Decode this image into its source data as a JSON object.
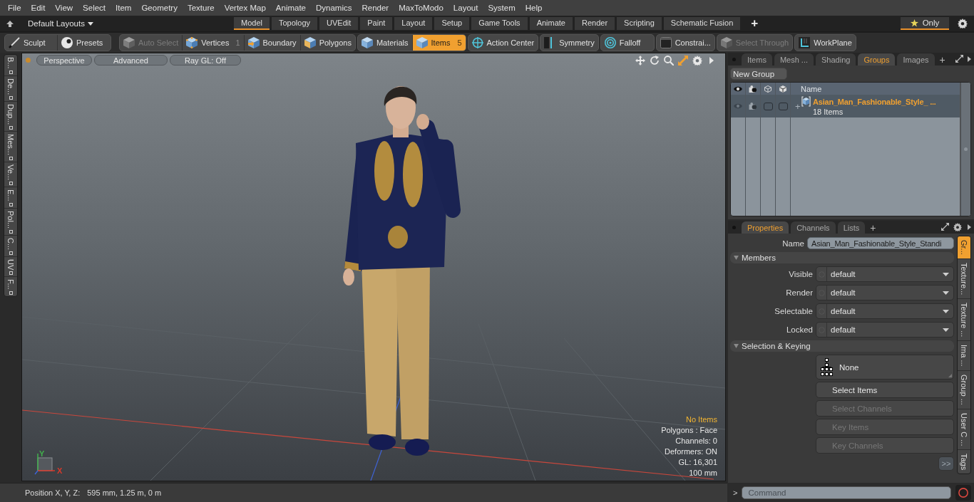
{
  "menu_bar": {
    "items": [
      "File",
      "Edit",
      "View",
      "Select",
      "Item",
      "Geometry",
      "Texture",
      "Vertex Map",
      "Animate",
      "Dynamics",
      "Render",
      "MaxToModo",
      "Layout",
      "System",
      "Help"
    ]
  },
  "layout_bar": {
    "layout_menu": "Default Layouts",
    "tabs": [
      {
        "label": "Model",
        "selected": true
      },
      {
        "label": "Topology",
        "selected": false
      },
      {
        "label": "UVEdit",
        "selected": false
      },
      {
        "label": "Paint",
        "selected": false
      },
      {
        "label": "Layout",
        "selected": false
      },
      {
        "label": "Setup",
        "selected": false
      },
      {
        "label": "Game Tools",
        "selected": false
      },
      {
        "label": "Animate",
        "selected": false
      },
      {
        "label": "Render",
        "selected": false
      },
      {
        "label": "Scripting",
        "selected": false
      },
      {
        "label": "Schematic Fusion",
        "selected": false
      }
    ],
    "add_tab": "+",
    "filter": {
      "label": "Only",
      "selected": true
    }
  },
  "toolbar": {
    "groups": [
      [
        {
          "label": "Sculpt",
          "selected": false,
          "disabled": false
        },
        {
          "label": "Presets",
          "selected": false,
          "disabled": false
        }
      ],
      [
        {
          "label": "Auto Select",
          "selected": false,
          "disabled": true
        },
        {
          "label": "Vertices",
          "selected": false,
          "disabled": false,
          "count": "1"
        },
        {
          "label": "Boundary",
          "selected": false,
          "disabled": false
        },
        {
          "label": "Polygons",
          "selected": false,
          "disabled": false
        }
      ],
      [
        {
          "label": "Materials",
          "selected": false,
          "disabled": false
        },
        {
          "label": "Items",
          "selected": true,
          "disabled": false,
          "count": "5"
        }
      ],
      [
        {
          "label": "Action Center",
          "selected": false,
          "disabled": false
        }
      ],
      [
        {
          "label": "Symmetry",
          "selected": false,
          "disabled": false
        }
      ],
      [
        {
          "label": "Falloff",
          "selected": false,
          "disabled": false
        }
      ],
      [
        {
          "label": "Constrai...",
          "selected": false,
          "disabled": false
        }
      ],
      [
        {
          "label": "Select Through",
          "selected": false,
          "disabled": true
        }
      ],
      [
        {
          "label": "WorkPlane",
          "selected": false,
          "disabled": false
        }
      ]
    ]
  },
  "left_tabs": [
    {
      "label": "B..."
    },
    {
      "label": "De..."
    },
    {
      "label": "Dup..."
    },
    {
      "label": "Mes..."
    },
    {
      "label": "Ve..."
    },
    {
      "label": "E..."
    },
    {
      "label": "Pol..."
    },
    {
      "label": "C..."
    },
    {
      "label": "UV"
    },
    {
      "label": "F..."
    }
  ],
  "viewport": {
    "buttons": [
      "Perspective",
      "Advanced",
      "Ray GL: Off"
    ],
    "info": [
      {
        "text": "No Items",
        "kind": "highlight"
      },
      {
        "text": "Polygons : Face",
        "kind": "normal"
      },
      {
        "text": "Channels: 0",
        "kind": "normal"
      },
      {
        "text": "Deformers: ON",
        "kind": "normal"
      },
      {
        "text": "GL: 16,301",
        "kind": "normal"
      },
      {
        "text": "100 mm",
        "kind": "normal"
      }
    ],
    "axis_labels": [
      {
        "text": "Y",
        "color": "#41b04c"
      },
      {
        "text": "X",
        "color": "#d9392b"
      }
    ]
  },
  "groups_panel": {
    "tabs": [
      {
        "label": "Items",
        "selected": false
      },
      {
        "label": "Mesh ...",
        "selected": false
      },
      {
        "label": "Shading",
        "selected": false
      },
      {
        "label": "Groups",
        "selected": true
      },
      {
        "label": "Images",
        "selected": false
      }
    ],
    "add_tab": "+",
    "new_group_button": "New Group",
    "name_column": "Name",
    "rows": [
      {
        "expander": "+",
        "name": "Asian_Man_Fashionable_Style_ ...",
        "count": "18 Items"
      }
    ]
  },
  "properties_panel": {
    "tabs": [
      {
        "label": "Properties",
        "selected": true
      },
      {
        "label": "Channels",
        "selected": false
      },
      {
        "label": "Lists",
        "selected": false
      }
    ],
    "add_tab": "+",
    "name_label": "Name",
    "name_value": "Asian_Man_Fashionable_Style_Standi",
    "sections": [
      {
        "title": "Members",
        "expanded": true,
        "kind": "fields",
        "fields": [
          {
            "label": "Visible",
            "value": "default"
          },
          {
            "label": "Render",
            "value": "default"
          },
          {
            "label": "Selectable",
            "value": "default"
          },
          {
            "label": "Locked",
            "value": "default"
          }
        ]
      },
      {
        "title": "Selection & Keying",
        "expanded": true,
        "kind": "buttons",
        "buttons": [
          {
            "label": "None",
            "kind": "preset",
            "disabled": false
          },
          {
            "label": "Select Items",
            "kind": "action",
            "disabled": false
          },
          {
            "label": "Select Channels",
            "kind": "action",
            "disabled": true
          },
          {
            "label": "Key Items",
            "kind": "action",
            "disabled": true
          },
          {
            "label": "Key Channels",
            "kind": "action",
            "disabled": true
          }
        ]
      }
    ],
    "more_button": ">>",
    "side_tabs": [
      {
        "label": "Gr...",
        "selected": true
      },
      {
        "label": "Texture...",
        "selected": false
      },
      {
        "label": "Texture ...",
        "selected": false
      },
      {
        "label": "Ima ...",
        "selected": false
      },
      {
        "label": "Group ...",
        "selected": false
      },
      {
        "label": "User C ...",
        "selected": false
      },
      {
        "label": "Tags",
        "selected": false
      }
    ]
  },
  "status_bar": {
    "label": "Position X, Y, Z:",
    "value": "595 mm, 1.25 m, 0 m"
  },
  "command_bar": {
    "prompt": ">",
    "placeholder": "Command"
  }
}
